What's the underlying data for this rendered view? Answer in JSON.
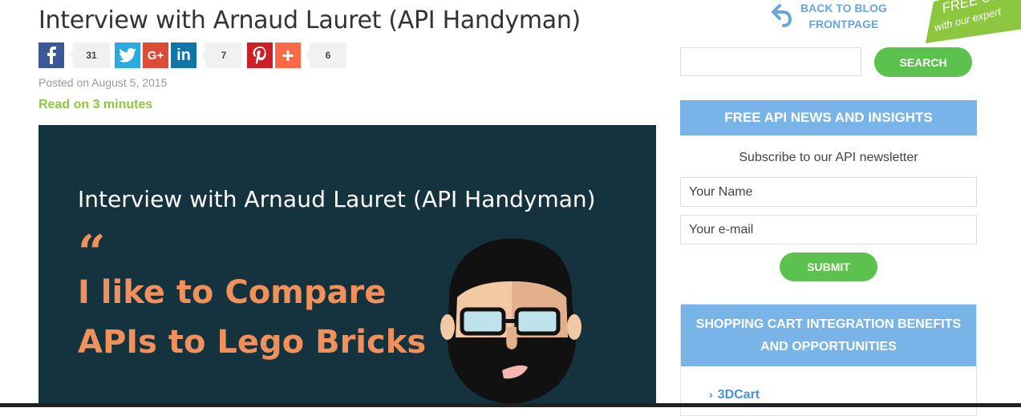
{
  "post": {
    "title": "Interview with Arnaud Lauret (API Handyman)",
    "posted": "Posted on August 5, 2015",
    "read_time": "Read on 3 minutes"
  },
  "share": {
    "facebook_count": "31",
    "linkedin_count": "7",
    "addthis_count": "6"
  },
  "hero": {
    "title_pre": "Interview with ",
    "title_name": "Arnaud Lauret",
    "title_post": " (API Handyman)",
    "quote_mark": "“",
    "quote_line1": "I like to Compare",
    "quote_line2": "APIs to Lego Bricks"
  },
  "sidebar": {
    "back_line1": "BACK TO BLOG",
    "back_line2": "FRONTPAGE",
    "free_call_line1": "FREE Call",
    "free_call_line2": "with our expert",
    "search_label": "SEARCH",
    "newsletter_title": "FREE API NEWS AND INSIGHTS",
    "newsletter_text": "Subscribe to our API newsletter",
    "name_placeholder": "Your Name",
    "email_placeholder": "Your e-mail",
    "submit_label": "SUBMIT",
    "cart_title_line1": "SHOPPING CART INTEGRATION BENEFITS",
    "cart_title_line2": "AND OPPORTUNITIES",
    "cart_items": [
      {
        "label": "3DCart"
      }
    ]
  },
  "colors": {
    "accent_green": "#5cc24e",
    "read_green": "#8dc63f",
    "sidebar_blue": "#79b4e8",
    "hero_bg": "#14333f",
    "hero_orange": "#f0905a"
  }
}
